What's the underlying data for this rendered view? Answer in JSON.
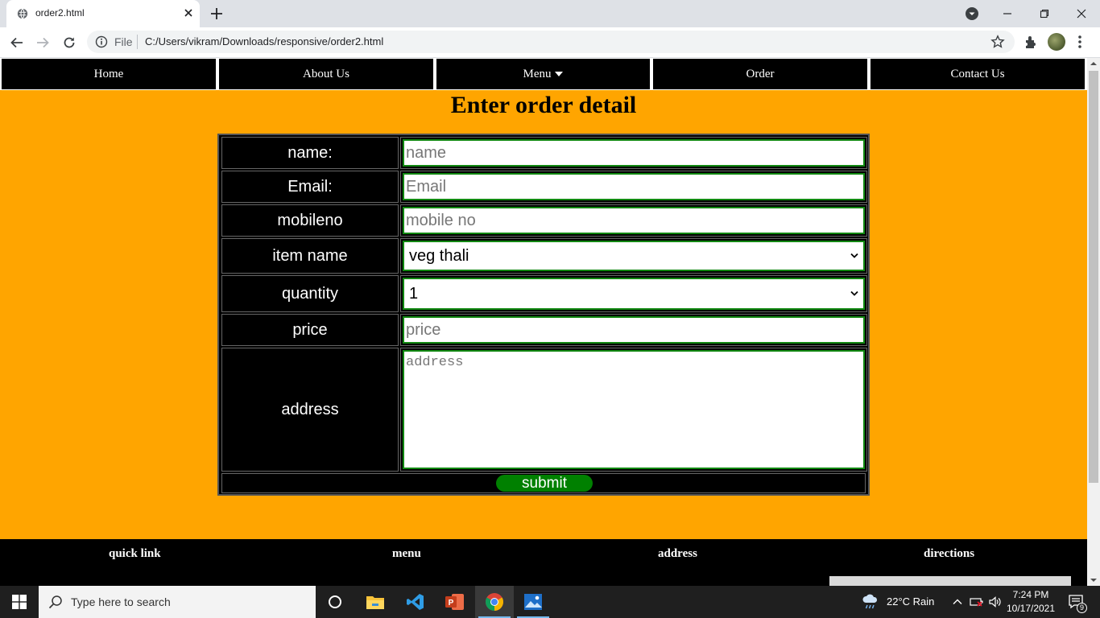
{
  "browser": {
    "tab_title": "order2.html",
    "url_scheme_label": "File",
    "url": "C:/Users/vikram/Downloads/responsive/order2.html"
  },
  "nav": {
    "items": [
      "Home",
      "About Us",
      "Menu",
      "Order",
      "Contact Us"
    ]
  },
  "page": {
    "heading": "Enter order detail",
    "form": {
      "name_label": "name:",
      "name_placeholder": "name",
      "email_label": "Email:",
      "email_placeholder": "Email",
      "mobile_label": "mobileno",
      "mobile_placeholder": "mobile no",
      "item_label": "item name",
      "item_selected": "veg thali",
      "quantity_label": "quantity",
      "quantity_selected": "1",
      "price_label": "price",
      "price_placeholder": "price",
      "address_label": "address",
      "address_placeholder": "address",
      "submit_label": "submit"
    },
    "footer": {
      "headings": [
        "quick link",
        "menu",
        "address",
        "directions"
      ]
    }
  },
  "taskbar": {
    "search_placeholder": "Type here to search",
    "weather": "22°C  Rain",
    "time": "7:24 PM",
    "date": "10/17/2021",
    "notification_count": "9"
  },
  "colors": {
    "page_background": "#ffa500",
    "nav_background": "#000000",
    "input_border": "#118811",
    "submit_button": "#008000"
  }
}
